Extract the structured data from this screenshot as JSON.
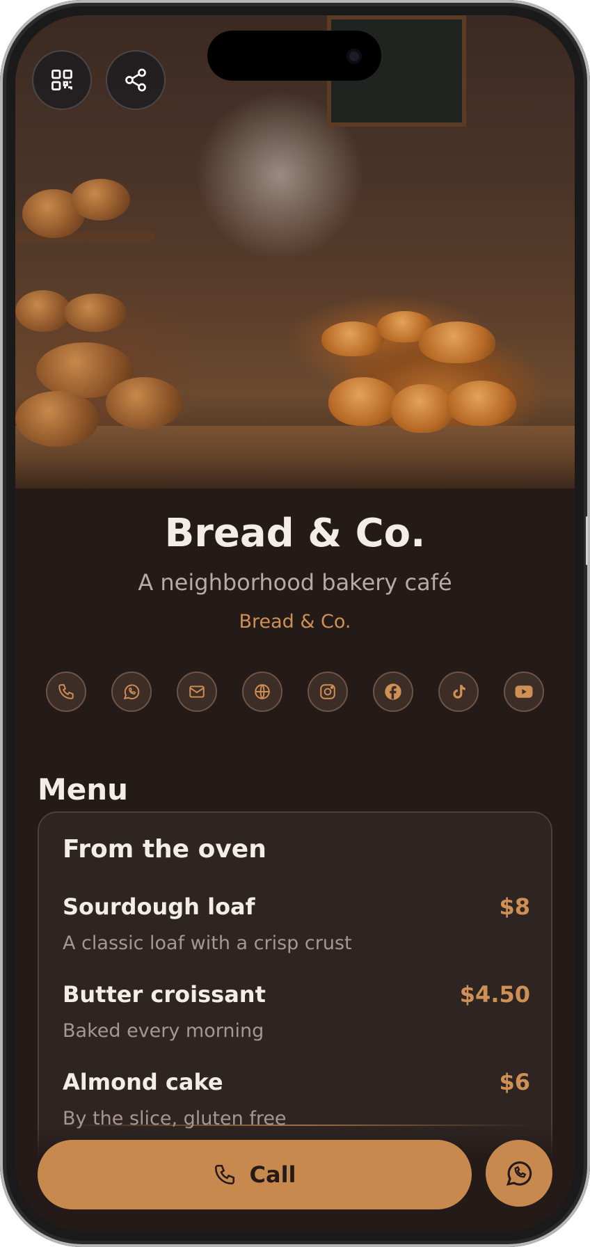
{
  "header": {
    "qr_icon": "qr-code-icon",
    "share_icon": "share-icon"
  },
  "profile": {
    "name": "Bread & Co.",
    "tagline": "A neighborhood bakery café",
    "brand": "Bread & Co."
  },
  "socials": [
    {
      "icon": "phone-icon"
    },
    {
      "icon": "whatsapp-icon"
    },
    {
      "icon": "mail-icon"
    },
    {
      "icon": "globe-icon"
    },
    {
      "icon": "instagram-icon"
    },
    {
      "icon": "facebook-icon"
    },
    {
      "icon": "tiktok-icon"
    },
    {
      "icon": "youtube-icon"
    }
  ],
  "menu": {
    "heading": "Menu",
    "section": "From the oven",
    "items": [
      {
        "name": "Sourdough loaf",
        "price": "$8",
        "desc": "A classic loaf with a crisp crust"
      },
      {
        "name": "Butter croissant",
        "price": "$4.50",
        "desc": "Baked every morning"
      },
      {
        "name": "Almond cake",
        "price": "$6",
        "desc": "By the slice, gluten free"
      }
    ]
  },
  "actions": {
    "call_label": "Call",
    "whatsapp_icon": "whatsapp-icon"
  },
  "colors": {
    "background": "#241b18",
    "accent": "#c8894f",
    "card": "#2e2523"
  }
}
